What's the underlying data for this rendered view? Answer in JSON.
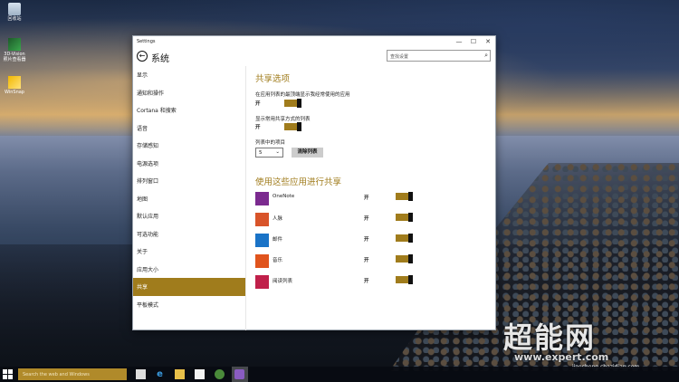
{
  "desktop": {
    "icons": [
      {
        "label": "回收站",
        "icon": "recycle-bin-icon"
      },
      {
        "label": "3D-Vision 照片查看器",
        "icon": "photo-viewer-icon"
      },
      {
        "label": "WinSnap",
        "icon": "shortcut-icon"
      }
    ]
  },
  "window": {
    "title": "Settings",
    "controls": {
      "minimize": "—",
      "maximize": "☐",
      "close": "✕"
    },
    "app_title": "系统",
    "search_placeholder": "查找设置"
  },
  "sidebar": {
    "items": [
      {
        "label": "显示",
        "active": false
      },
      {
        "label": "通知和操作",
        "active": false
      },
      {
        "label": "Cortana 和搜索",
        "active": false
      },
      {
        "label": "语音",
        "active": false
      },
      {
        "label": "存储感知",
        "active": false
      },
      {
        "label": "电源选项",
        "active": false
      },
      {
        "label": "排列窗口",
        "active": false
      },
      {
        "label": "地图",
        "active": false
      },
      {
        "label": "默认应用",
        "active": false
      },
      {
        "label": "可选功能",
        "active": false
      },
      {
        "label": "关于",
        "active": false
      },
      {
        "label": "应用大小",
        "active": false
      },
      {
        "label": "共享",
        "active": true
      },
      {
        "label": "平板模式",
        "active": false
      }
    ]
  },
  "share": {
    "heading": "共享选项",
    "option1_label": "在应用列表的最顶端显示我经常使用的应用",
    "option1_state": "开",
    "option2_label": "显示常用共享方式的列表",
    "option2_state": "开",
    "list_count_label": "列表中的项目",
    "list_count_value": "5",
    "clear_button": "清除列表",
    "apps_heading": "使用这些应用进行共享",
    "apps": [
      {
        "name": "OneNote",
        "state": "开",
        "color": "#7b2a8f",
        "icon": "onenote-icon"
      },
      {
        "name": "人脉",
        "state": "开",
        "color": "#d8542a",
        "icon": "people-icon"
      },
      {
        "name": "邮件",
        "state": "开",
        "color": "#1a73c7",
        "icon": "mail-icon"
      },
      {
        "name": "音乐",
        "state": "开",
        "color": "#e0541d",
        "icon": "music-icon"
      },
      {
        "name": "阅读列表",
        "state": "开",
        "color": "#c0204a",
        "icon": "reading-list-icon"
      }
    ]
  },
  "taskbar": {
    "search_placeholder": "Search the web and Windows"
  },
  "watermark": {
    "brand": "超能网",
    "url": "www.expert.com",
    "sub": "jiaocheng.chazidian.com"
  },
  "colors": {
    "accent": "#a07c1c"
  }
}
